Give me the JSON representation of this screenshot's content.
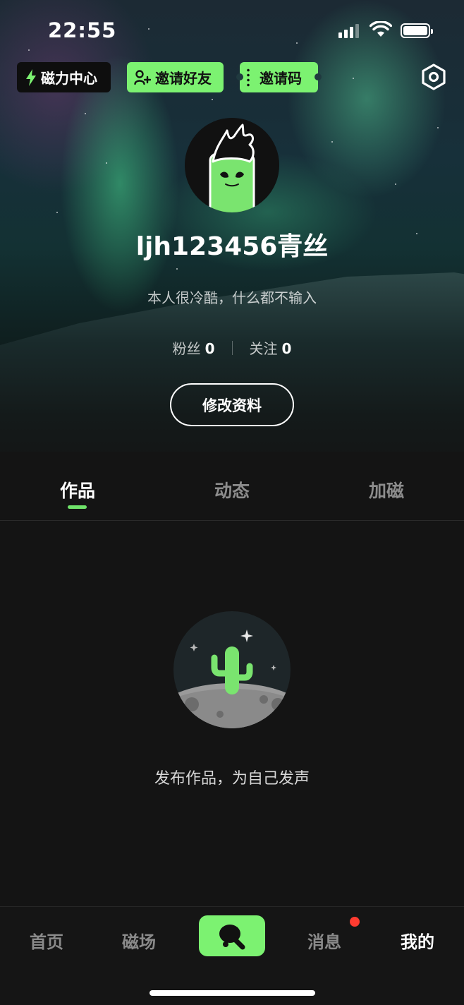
{
  "status_bar": {
    "time": "22:55"
  },
  "header": {
    "magnet_center_label": "磁力中心",
    "invite_friends_label": "邀请好友",
    "invite_code_label": "邀请码"
  },
  "profile": {
    "username": "ljh123456青丝",
    "bio": "本人很冷酷，什么都不输入",
    "fans_label": "粉丝",
    "fans_count": "0",
    "following_label": "关注",
    "following_count": "0",
    "edit_button_label": "修改资料"
  },
  "tabs": [
    {
      "label": "作品",
      "active": true
    },
    {
      "label": "动态",
      "active": false
    },
    {
      "label": "加磁",
      "active": false
    }
  ],
  "empty_state": {
    "text": "发布作品，为自己发声"
  },
  "bottom_nav": {
    "items": [
      {
        "label": "首页",
        "active": false
      },
      {
        "label": "磁场",
        "active": false
      },
      {
        "label": "消息",
        "active": false,
        "badge": true
      },
      {
        "label": "我的",
        "active": true
      }
    ],
    "center_icon": "ping-pong-paddle-icon"
  },
  "colors": {
    "accent": "#7cf271",
    "badge": "#ff3b30",
    "background": "#141414"
  }
}
